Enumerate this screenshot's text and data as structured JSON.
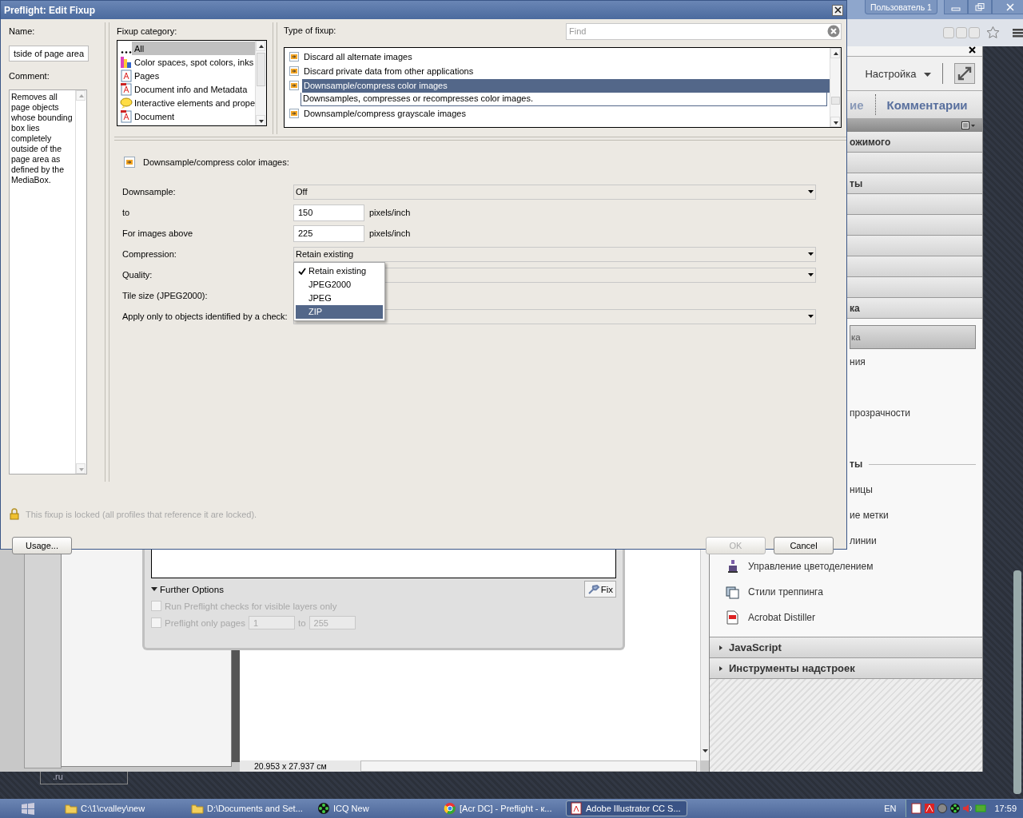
{
  "browser": {
    "profile_button": "Пользователь 1"
  },
  "side_panel": {
    "customize": "Настройка",
    "tabs": [
      {
        "label": "ие",
        "selected": false
      },
      {
        "label": "Комментарии",
        "selected": true
      }
    ],
    "header_rows": [
      {
        "kind": "header",
        "label": "ожимого"
      },
      {
        "kind": "blank"
      },
      {
        "kind": "header",
        "label": "ты"
      },
      {
        "kind": "blank"
      },
      {
        "kind": "blank"
      },
      {
        "kind": "blank"
      },
      {
        "kind": "blank"
      },
      {
        "kind": "blank"
      },
      {
        "kind": "header",
        "label": "ка"
      }
    ],
    "entries": [
      {
        "kind": "button",
        "label": "ка"
      },
      {
        "kind": "link",
        "label": "ния"
      },
      {
        "kind": "covered"
      },
      {
        "kind": "link",
        "label": "прозрачности"
      },
      {
        "kind": "covered"
      },
      {
        "kind": "subheading",
        "label": "ты"
      },
      {
        "kind": "link",
        "label": "ницы"
      },
      {
        "kind": "link",
        "label": "ие метки"
      },
      {
        "kind": "link",
        "label": "линии"
      },
      {
        "kind": "tool",
        "label": "Управление цветоделением"
      },
      {
        "kind": "tool",
        "label": "Стили треппинга"
      },
      {
        "kind": "tool",
        "label": "Acrobat Distiller"
      }
    ],
    "sections": [
      {
        "label": "JavaScript",
        "expanded": false
      },
      {
        "label": "Инструменты надстроек",
        "expanded": false
      }
    ]
  },
  "preflight_panel": {
    "further_options": "Further Options",
    "expanded": true,
    "fix_button": "Fix",
    "options": [
      {
        "label": "Run Preflight checks for visible layers only",
        "checked": false,
        "disabled": true
      },
      {
        "label": "Preflight only pages",
        "checked": false,
        "disabled": true,
        "from": "1",
        "to_label": "to",
        "to": "255"
      }
    ]
  },
  "document": {
    "size": "20.953 x 27.937 см"
  },
  "desktop_label": ".ru",
  "dialog": {
    "title": "Preflight: Edit Fixup",
    "name_label": "Name:",
    "name_value": "tside of page area",
    "comment_label": "Comment:",
    "comment": "Removes all page objects whose bounding box lies completely outside of the page area as defined by the MediaBox.",
    "category_label": "Fixup category:",
    "categories": [
      {
        "label": "All",
        "selected": true
      },
      {
        "label": "Color spaces, spot colors, inks",
        "selected": false
      },
      {
        "label": "Pages",
        "selected": false
      },
      {
        "label": "Document info and Metadata",
        "selected": false
      },
      {
        "label": "Interactive elements and prope",
        "selected": false
      },
      {
        "label": "Document",
        "selected": false
      }
    ],
    "type_label": "Type of fixup:",
    "find_placeholder": "Find",
    "fixup_types": [
      {
        "label": "Discard all alternate images",
        "selected": false
      },
      {
        "label": "Discard private data from other applications",
        "selected": false
      },
      {
        "label": "Downsample/compress color images",
        "selected": true,
        "description": "Downsamples, compresses or recompresses color images."
      },
      {
        "label": "Downsample/compress grayscale images",
        "selected": false
      }
    ],
    "section_title": "Downsample/compress color images:",
    "fields": [
      {
        "label": "Downsample:",
        "kind": "select",
        "value": "Off"
      },
      {
        "label": "to",
        "kind": "number",
        "value": "150",
        "unit": "pixels/inch"
      },
      {
        "label": "For images above",
        "kind": "number",
        "value": "225",
        "unit": "pixels/inch"
      },
      {
        "label": "Compression:",
        "kind": "select",
        "value": "Retain existing"
      },
      {
        "label": "Quality:",
        "kind": "select"
      },
      {
        "label": "Tile size (JPEG2000):",
        "kind": "none"
      },
      {
        "label": "Apply only to objects identified by a check:",
        "kind": "select"
      }
    ],
    "menu": {
      "items": [
        {
          "label": "Retain existing",
          "checked": true,
          "selected": false
        },
        {
          "label": "JPEG2000",
          "checked": false,
          "selected": false
        },
        {
          "label": "JPEG",
          "checked": false,
          "selected": false
        },
        {
          "label": "ZIP",
          "checked": false,
          "selected": true
        }
      ]
    },
    "lock_note": "This fixup is locked (all profiles that reference it are locked).",
    "buttons": [
      {
        "label": "Usage...",
        "disabled": false
      },
      {
        "label": "OK",
        "disabled": true
      },
      {
        "label": "Cancel",
        "disabled": false
      }
    ]
  },
  "taskbar": {
    "items": [
      {
        "label": "C:\\1\\cvalley\\new",
        "selected": false
      },
      {
        "label": "D:\\Documents and Set...",
        "selected": false
      },
      {
        "label": "ICQ New",
        "selected": false
      },
      {
        "label": "[Acr DC] - Preflight - к...",
        "selected": false
      },
      {
        "label": "Adobe Illustrator CC S...",
        "selected": true
      }
    ],
    "language": "EN",
    "clock": "17:59"
  }
}
